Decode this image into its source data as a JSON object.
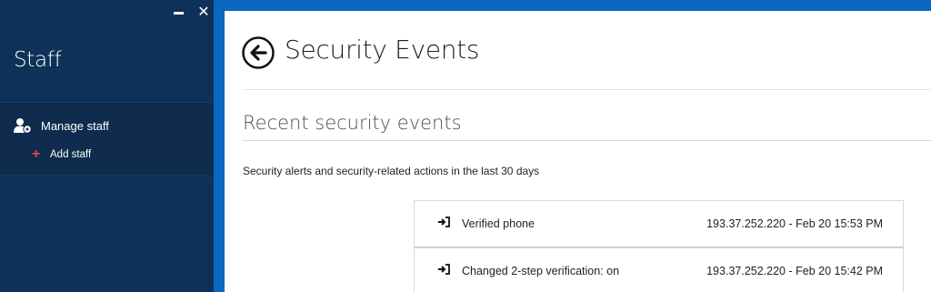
{
  "sidebar": {
    "title": "Staff",
    "nav": {
      "manage_label": "Manage staff",
      "add_label": "Add staff"
    }
  },
  "window": {
    "minimize_icon": "minimize-icon",
    "close_icon": "close-icon"
  },
  "main": {
    "title": "Security Events",
    "section_title": "Recent security events",
    "description": "Security alerts and security-related actions in the last 30 days",
    "events": [
      {
        "label": "Verified phone",
        "meta": "193.37.252.220 - Feb 20 15:53 PM",
        "icon": "sign-in-icon"
      },
      {
        "label": "Changed 2-step verification: on",
        "meta": "193.37.252.220 - Feb 20 15:42 PM",
        "icon": "sign-in-icon"
      }
    ]
  },
  "colors": {
    "sidebar_bg": "#0d3159",
    "window_frame": "#0b68c0",
    "accent_plus": "#e0463a"
  }
}
